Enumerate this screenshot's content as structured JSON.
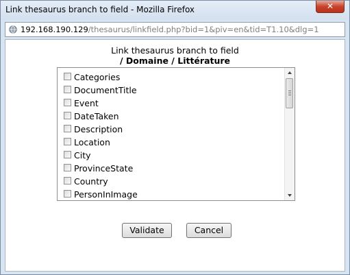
{
  "window": {
    "title": "Link thesaurus branch to field - Mozilla Firefox",
    "close_label": "✕"
  },
  "urlbar": {
    "host": "192.168.190.129",
    "path": "/thesaurus/linkfield.php?bid=1&piv=en&tid=T1.10&dlg=1"
  },
  "dialog": {
    "heading": "Link thesaurus branch to field",
    "branch": "/ Domaine / Littérature",
    "fields": [
      {
        "label": "Categories",
        "checked": false
      },
      {
        "label": "DocumentTitle",
        "checked": false
      },
      {
        "label": "Event",
        "checked": false
      },
      {
        "label": "DateTaken",
        "checked": false
      },
      {
        "label": "Description",
        "checked": false
      },
      {
        "label": "Location",
        "checked": false
      },
      {
        "label": "City",
        "checked": false
      },
      {
        "label": "ProvinceState",
        "checked": false
      },
      {
        "label": "Country",
        "checked": false
      },
      {
        "label": "PersonInImage",
        "checked": false
      }
    ],
    "validate_label": "Validate",
    "cancel_label": "Cancel"
  }
}
